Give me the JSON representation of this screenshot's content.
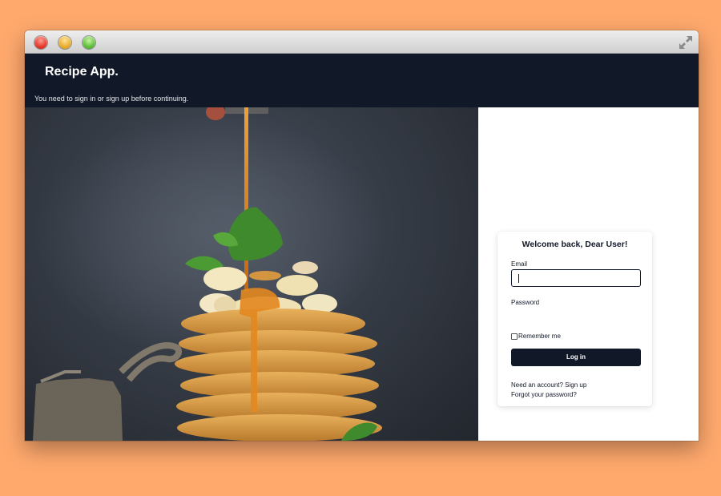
{
  "navbar": {
    "brand": "Recipe App.",
    "flash_message": "You need to sign in or sign up before continuing."
  },
  "login": {
    "title": "Welcome back, Dear User!",
    "email_label": "Email",
    "email_value": "",
    "password_label": "Password",
    "password_value": "",
    "remember_label": "Remember me",
    "remember_checked": false,
    "submit_label": "Log in",
    "signup_link": "Need an account? Sign up",
    "forgot_link": "Forgot your password?"
  },
  "colors": {
    "background": "#ffa96d",
    "navbar": "#111827",
    "button": "#111827"
  },
  "icons": {
    "close": "close-traffic-light-icon",
    "minimize": "minimize-traffic-light-icon",
    "zoom": "zoom-traffic-light-icon",
    "fullscreen": "fullscreen-arrows-icon"
  }
}
